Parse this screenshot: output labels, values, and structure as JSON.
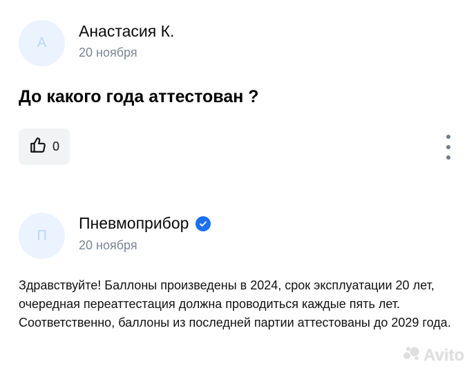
{
  "review": {
    "avatar_letter": "А",
    "author": "Анастасия К.",
    "date": "20 ноября",
    "question": "До какого года аттестован ?",
    "likes": "0"
  },
  "reply": {
    "avatar_letter": "П",
    "author": "Пневмоприбор",
    "verified": true,
    "date": "20 ноября",
    "text": "Здравствуйте! Баллоны произведены в 2024, срок эксплуатации 20 лет, очередная переаттестация должна проводиться каждые пять лет. Соответственно, баллоны из последней партии аттестованы до 2029 года."
  },
  "watermark": {
    "text": "Avito"
  },
  "icons": {
    "like": "thumbs-up-icon",
    "more": "more-vertical-icon",
    "verified": "verified-check-icon"
  },
  "colors": {
    "avatar_bg": "#eaf3ff",
    "date": "#7a8593",
    "verified": "#1d6ff2",
    "like_bg": "#f2f3f5"
  }
}
